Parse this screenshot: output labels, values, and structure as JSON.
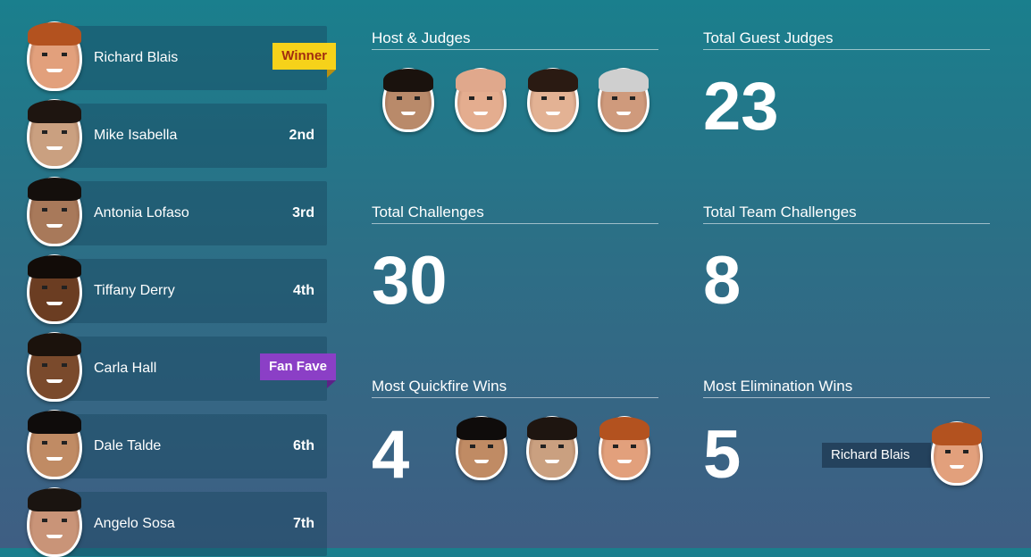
{
  "roster": [
    {
      "name": "Richard Blais",
      "place": "",
      "badge": "Winner",
      "hair": "#b3521f",
      "skin": "#e2a07c"
    },
    {
      "name": "Mike Isabella",
      "place": "2nd",
      "badge": "",
      "hair": "#1e1510",
      "skin": "#caa080"
    },
    {
      "name": "Antonia Lofaso",
      "place": "3rd",
      "badge": "",
      "hair": "#140f0c",
      "skin": "#a8795a"
    },
    {
      "name": "Tiffany Derry",
      "place": "4th",
      "badge": "",
      "hair": "#120c08",
      "skin": "#6b3d22"
    },
    {
      "name": "Carla Hall",
      "place": "",
      "badge": "Fan Fave",
      "hair": "#1b120c",
      "skin": "#7a4a2c"
    },
    {
      "name": "Dale Talde",
      "place": "6th",
      "badge": "",
      "hair": "#0f0c0b",
      "skin": "#c08b64"
    },
    {
      "name": "Angelo Sosa",
      "place": "7th",
      "badge": "",
      "hair": "#1a1410",
      "skin": "#c99478"
    }
  ],
  "stats": {
    "host_judges": {
      "title": "Host & Judges"
    },
    "guest_judges": {
      "title": "Total Guest Judges",
      "value": "23"
    },
    "challenges": {
      "title": "Total Challenges",
      "value": "30"
    },
    "team_challenges": {
      "title": "Total Team Challenges",
      "value": "8"
    },
    "quickfire": {
      "title": "Most Quickfire Wins",
      "value": "4"
    },
    "elimination": {
      "title": "Most Elimination Wins",
      "value": "5",
      "name": "Richard Blais"
    }
  },
  "judge_faces": [
    {
      "hair": "#1a120d",
      "skin": "#b98a6a"
    },
    {
      "hair": "#e0a88c",
      "skin": "#e4ad8f"
    },
    {
      "hair": "#2a1a12",
      "skin": "#e3b294"
    },
    {
      "hair": "#cfcfcf",
      "skin": "#cf9a7c"
    }
  ],
  "quickfire_faces": [
    {
      "hair": "#0f0c0b",
      "skin": "#c08b64"
    },
    {
      "hair": "#1e1510",
      "skin": "#caa080"
    },
    {
      "hair": "#b3521f",
      "skin": "#e2a07c"
    }
  ],
  "elimination_face": {
    "hair": "#b3521f",
    "skin": "#e2a07c"
  },
  "colors": {
    "winner_badge": "#f6d21a",
    "fan_badge": "#8b3fc6"
  }
}
